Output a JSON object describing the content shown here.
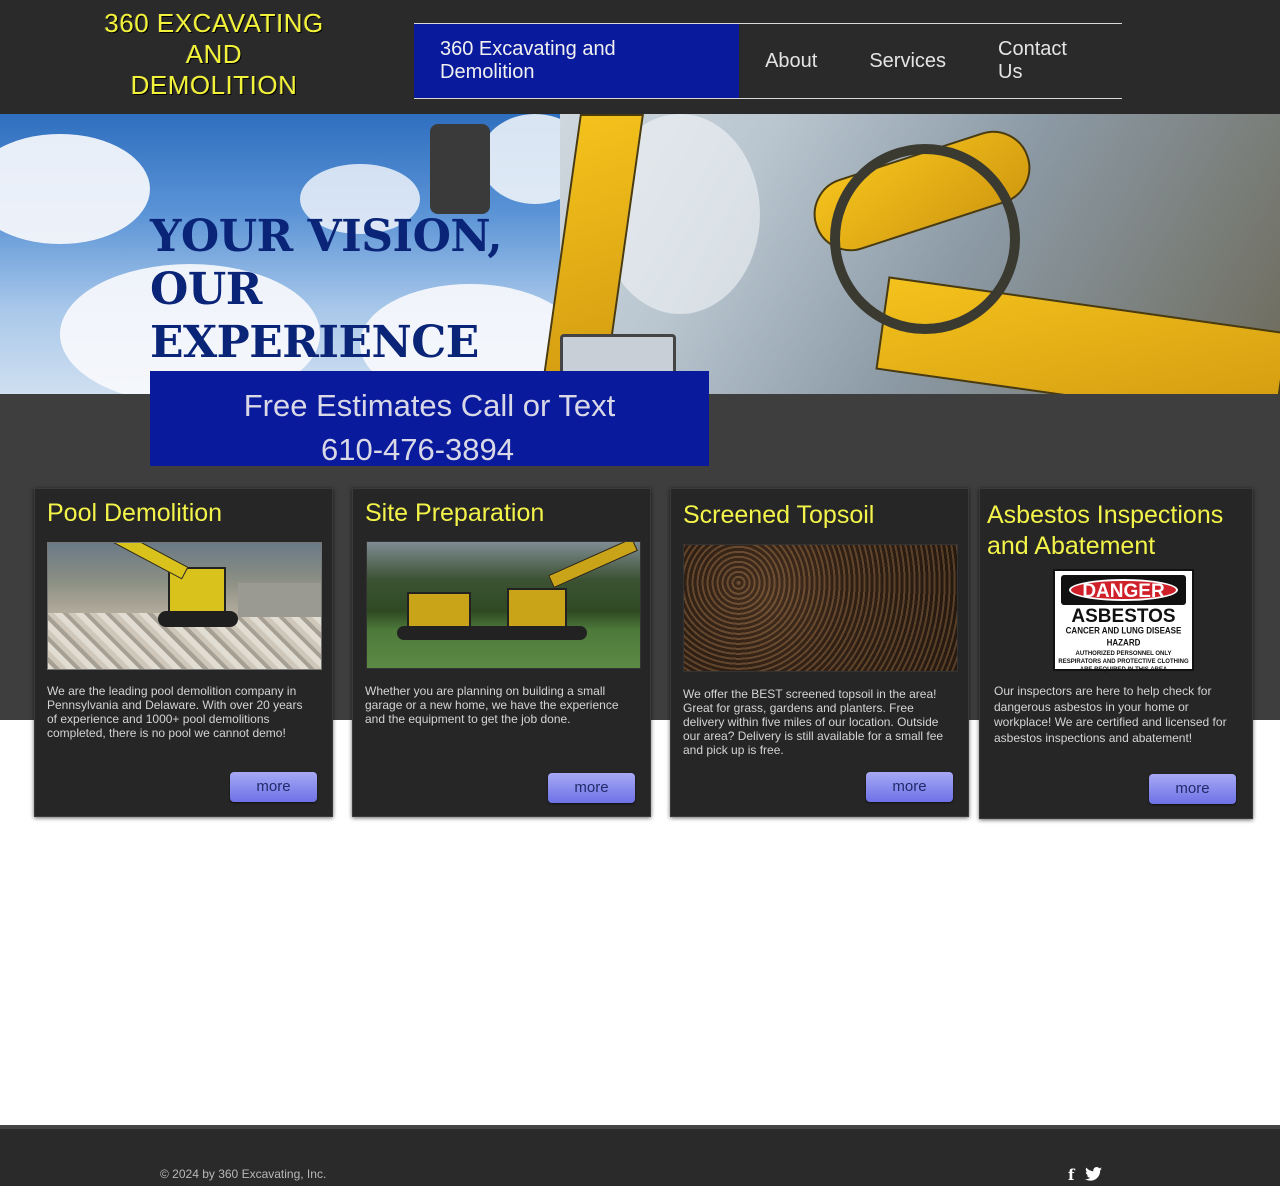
{
  "header": {
    "logo_lines": [
      "360 EXCAVATING",
      "AND",
      "DEMOLITION"
    ],
    "nav": [
      {
        "label": "360 Excavating and Demolition",
        "active": true
      },
      {
        "label": "About"
      },
      {
        "label": "Services"
      },
      {
        "label": "Contact Us"
      }
    ]
  },
  "hero": {
    "title_line1": "YOUR VISION, OUR",
    "title_line2": "EXPERIENCE"
  },
  "estimate": {
    "line1": "Free Estimates Call or Text",
    "phone": "610-476-3894"
  },
  "cards": [
    {
      "title": "Pool Demolition",
      "text": "We  are the leading pool demolition company in Pennsylvania and  Delaware. With over 20 years of experience and 1000+ pool demolitions  completed, there is no pool we cannot demo!",
      "more": "more"
    },
    {
      "title": "Site Preparation",
      "text": "Whether you are planning on building a small garage or a new home, we have the experience and the equipment to get the job done.",
      "more": "more"
    },
    {
      "title": "Screened Topsoil",
      "text": "We offer the BEST screened topsoil in the area! Great for grass, gardens and planters. Free delivery within five miles of our location. Outside our area? Delivery is still available for a small fee and pick up is free.",
      "more": "more"
    },
    {
      "title": "Asbestos Inspections and Abatement",
      "text": "Our inspectors are here to help check for dangerous asbestos in your home or workplace! We are certified and licensed for asbestos inspections and abatement!",
      "more": "more",
      "sign": {
        "danger": "DANGER",
        "asbestos": "ASBESTOS",
        "hazard": "CANCER AND LUNG DISEASE HAZARD",
        "line1": "AUTHORIZED PERSONNEL ONLY",
        "line2": "RESPIRATORS AND PROTECTIVE CLOTHING",
        "line3": "ARE REQUIRED IN THIS AREA"
      }
    }
  ],
  "footer": {
    "copyright": "© 2024 by 360 Excavating, Inc.",
    "social": [
      {
        "icon": "facebook-icon",
        "glyph": "f"
      },
      {
        "icon": "twitter-icon",
        "glyph": "🐦"
      }
    ]
  },
  "colors": {
    "nav_active": "#0a1a9c",
    "logo_yellow": "#f2f23a",
    "card_title_yellow": "#f3f34a",
    "hero_title_blue": "#0a2478"
  }
}
